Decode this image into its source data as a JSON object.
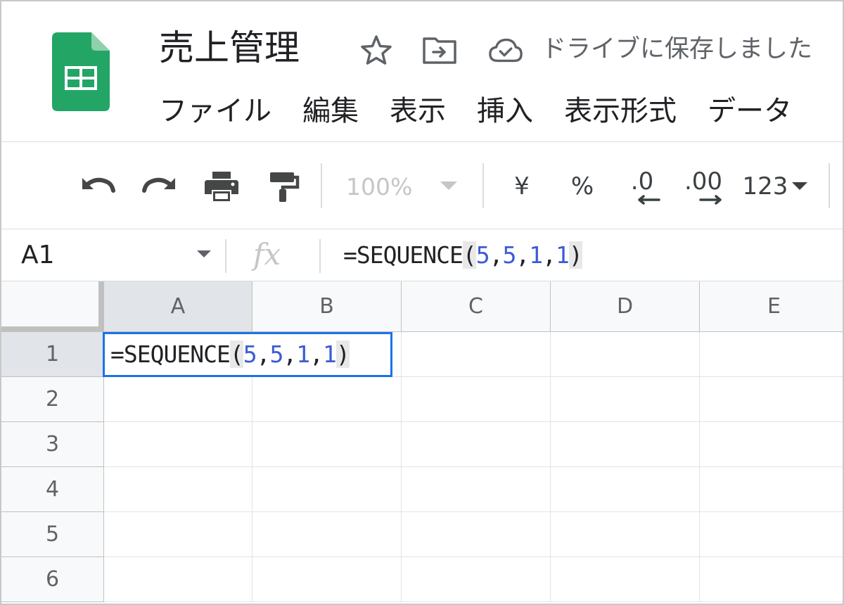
{
  "document": {
    "title": "売上管理",
    "save_status": "ドライブに保存しました"
  },
  "icons": {
    "logo": "google-sheets-logo",
    "star": "star-icon",
    "move": "move-to-folder-icon",
    "cloud": "cloud-done-icon"
  },
  "menu": [
    "ファイル",
    "編集",
    "表示",
    "挿入",
    "表示形式",
    "データ"
  ],
  "toolbar": {
    "zoom": "100%",
    "currency": "¥",
    "percent": "%",
    "decrease_decimal": ".0",
    "increase_decimal": ".00",
    "more_formats": "123"
  },
  "formula_bar": {
    "name_box": "A1",
    "fx": "fx",
    "formula": {
      "fn": "=SEQUENCE",
      "open": "(",
      "args": [
        "5",
        "5",
        "1",
        "1"
      ],
      "sep": ",",
      "close": ")"
    }
  },
  "grid": {
    "columns": [
      "A",
      "B",
      "C",
      "D",
      "E"
    ],
    "rows": [
      "1",
      "2",
      "3",
      "4",
      "5",
      "6"
    ],
    "active_cell": "A1"
  },
  "colors": {
    "accent": "#1a73e8",
    "sheets_green": "#23a566",
    "argument_blue": "#3c5bd6"
  }
}
